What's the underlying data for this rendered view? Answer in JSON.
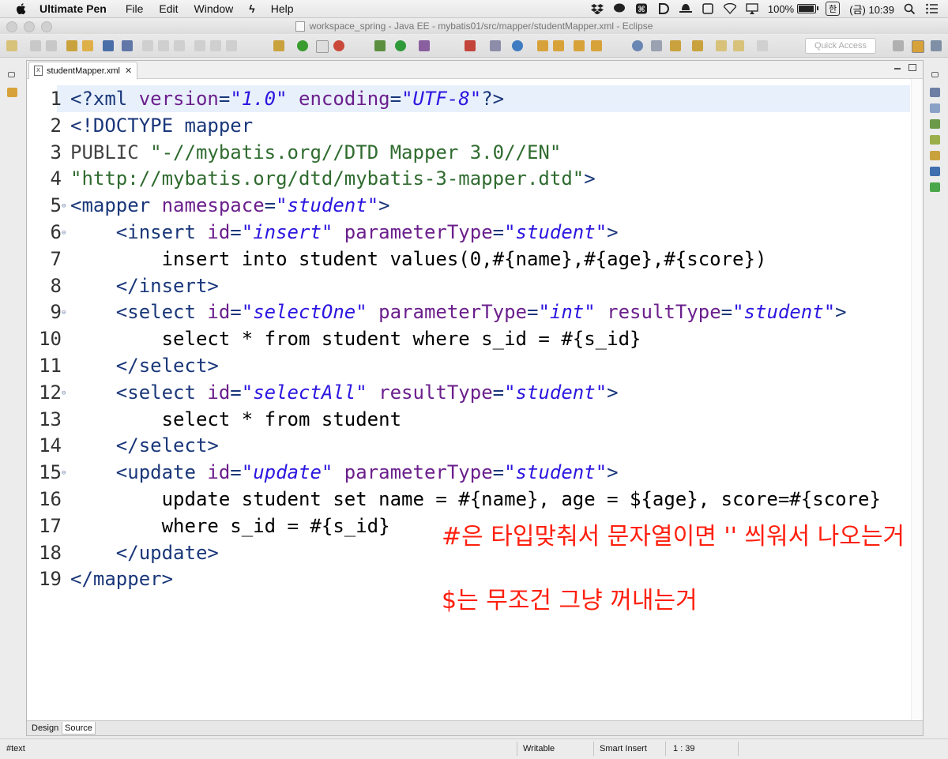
{
  "menubar": {
    "app_name": "Ultimate Pen",
    "items": [
      "File",
      "Edit",
      "Window",
      "Help"
    ],
    "battery": "100%",
    "battery_level": 1.0,
    "input_method": "한",
    "clock": "(금) 10:39"
  },
  "window": {
    "title": "workspace_spring - Java EE - mybatis01/src/mapper/studentMapper.xml - Eclipse"
  },
  "toolbar": {
    "quick_access_placeholder": "Quick Access"
  },
  "editor": {
    "tab_label": "studentMapper.xml",
    "bottom_tabs": [
      "Design",
      "Source"
    ],
    "active_bottom_tab": "Source",
    "current_line": 1,
    "lines": [
      {
        "n": "1",
        "fold": false,
        "segs": [
          [
            "tag",
            "<?xml "
          ],
          [
            "attr",
            "version"
          ],
          [
            "tag",
            "="
          ],
          [
            "val",
            "\"1.0\""
          ],
          [
            "tag",
            " "
          ],
          [
            "attr",
            "encoding"
          ],
          [
            "tag",
            "="
          ],
          [
            "val",
            "\"UTF-8\""
          ],
          [
            "tag",
            "?>"
          ]
        ]
      },
      {
        "n": "2",
        "fold": false,
        "segs": [
          [
            "tag",
            "<!DOCTYPE mapper"
          ]
        ]
      },
      {
        "n": "3",
        "fold": false,
        "segs": [
          [
            "doctext",
            "PUBLIC "
          ],
          [
            "dstr",
            "\"-//mybatis.org//DTD Mapper 3.0//EN\""
          ]
        ]
      },
      {
        "n": "4",
        "fold": false,
        "segs": [
          [
            "dstr",
            "\"http://mybatis.org/dtd/mybatis-3-mapper.dtd\""
          ],
          [
            "tag",
            ">"
          ]
        ]
      },
      {
        "n": "5",
        "fold": true,
        "segs": [
          [
            "tag",
            "<mapper "
          ],
          [
            "attr",
            "namespace"
          ],
          [
            "tag",
            "="
          ],
          [
            "val",
            "\"student\""
          ],
          [
            "tag",
            ">"
          ]
        ]
      },
      {
        "n": "6",
        "fold": true,
        "segs": [
          [
            "text",
            "    "
          ],
          [
            "tag",
            "<insert "
          ],
          [
            "attr",
            "id"
          ],
          [
            "tag",
            "="
          ],
          [
            "val",
            "\"insert\""
          ],
          [
            "tag",
            " "
          ],
          [
            "attr",
            "parameterType"
          ],
          [
            "tag",
            "="
          ],
          [
            "val",
            "\"student\""
          ],
          [
            "tag",
            ">"
          ]
        ]
      },
      {
        "n": "7",
        "fold": false,
        "segs": [
          [
            "text",
            "        insert into student values(0,#{name},#{age},#{score})"
          ]
        ]
      },
      {
        "n": "8",
        "fold": false,
        "segs": [
          [
            "text",
            "    "
          ],
          [
            "tag",
            "</insert>"
          ]
        ]
      },
      {
        "n": "9",
        "fold": true,
        "segs": [
          [
            "text",
            "    "
          ],
          [
            "tag",
            "<select "
          ],
          [
            "attr",
            "id"
          ],
          [
            "tag",
            "="
          ],
          [
            "val",
            "\"selectOne\""
          ],
          [
            "tag",
            " "
          ],
          [
            "attr",
            "parameterType"
          ],
          [
            "tag",
            "="
          ],
          [
            "val",
            "\"int\""
          ],
          [
            "tag",
            " "
          ],
          [
            "attr",
            "resultType"
          ],
          [
            "tag",
            "="
          ],
          [
            "val",
            "\"student\""
          ],
          [
            "tag",
            ">"
          ]
        ]
      },
      {
        "n": "10",
        "fold": false,
        "segs": [
          [
            "text",
            "        select * from student where s_id = #{s_id}"
          ]
        ]
      },
      {
        "n": "11",
        "fold": false,
        "segs": [
          [
            "text",
            "    "
          ],
          [
            "tag",
            "</select>"
          ]
        ]
      },
      {
        "n": "12",
        "fold": true,
        "segs": [
          [
            "text",
            "    "
          ],
          [
            "tag",
            "<select "
          ],
          [
            "attr",
            "id"
          ],
          [
            "tag",
            "="
          ],
          [
            "val",
            "\"selectAll\""
          ],
          [
            "tag",
            " "
          ],
          [
            "attr",
            "resultType"
          ],
          [
            "tag",
            "="
          ],
          [
            "val",
            "\"student\""
          ],
          [
            "tag",
            ">"
          ]
        ]
      },
      {
        "n": "13",
        "fold": false,
        "segs": [
          [
            "text",
            "        select * from student"
          ]
        ]
      },
      {
        "n": "14",
        "fold": false,
        "segs": [
          [
            "text",
            "    "
          ],
          [
            "tag",
            "</select>"
          ]
        ]
      },
      {
        "n": "15",
        "fold": true,
        "segs": [
          [
            "text",
            "    "
          ],
          [
            "tag",
            "<update "
          ],
          [
            "attr",
            "id"
          ],
          [
            "tag",
            "="
          ],
          [
            "val",
            "\"update\""
          ],
          [
            "tag",
            " "
          ],
          [
            "attr",
            "parameterType"
          ],
          [
            "tag",
            "="
          ],
          [
            "val",
            "\"student\""
          ],
          [
            "tag",
            ">"
          ]
        ]
      },
      {
        "n": "16",
        "fold": false,
        "segs": [
          [
            "text",
            "        update student set name = #{name}, age = ${age}, score=#{score}"
          ]
        ]
      },
      {
        "n": "17",
        "fold": false,
        "segs": [
          [
            "text",
            "        where s_id = #{s_id}"
          ]
        ]
      },
      {
        "n": "18",
        "fold": false,
        "segs": [
          [
            "text",
            "    "
          ],
          [
            "tag",
            "</update>"
          ]
        ]
      },
      {
        "n": "19",
        "fold": false,
        "segs": [
          [
            "tag",
            "</mapper>"
          ]
        ]
      }
    ]
  },
  "annotations": {
    "note1": "#은 타입맞춰서 문자열이면 '' 씌워서 나오는거",
    "note2": "$는 무조건 그냥 꺼내는거",
    "color": "#ff1f0e"
  },
  "statusbar": {
    "path": "#text",
    "writable": "Writable",
    "insert_mode": "Smart Insert",
    "position": "1 : 39"
  }
}
